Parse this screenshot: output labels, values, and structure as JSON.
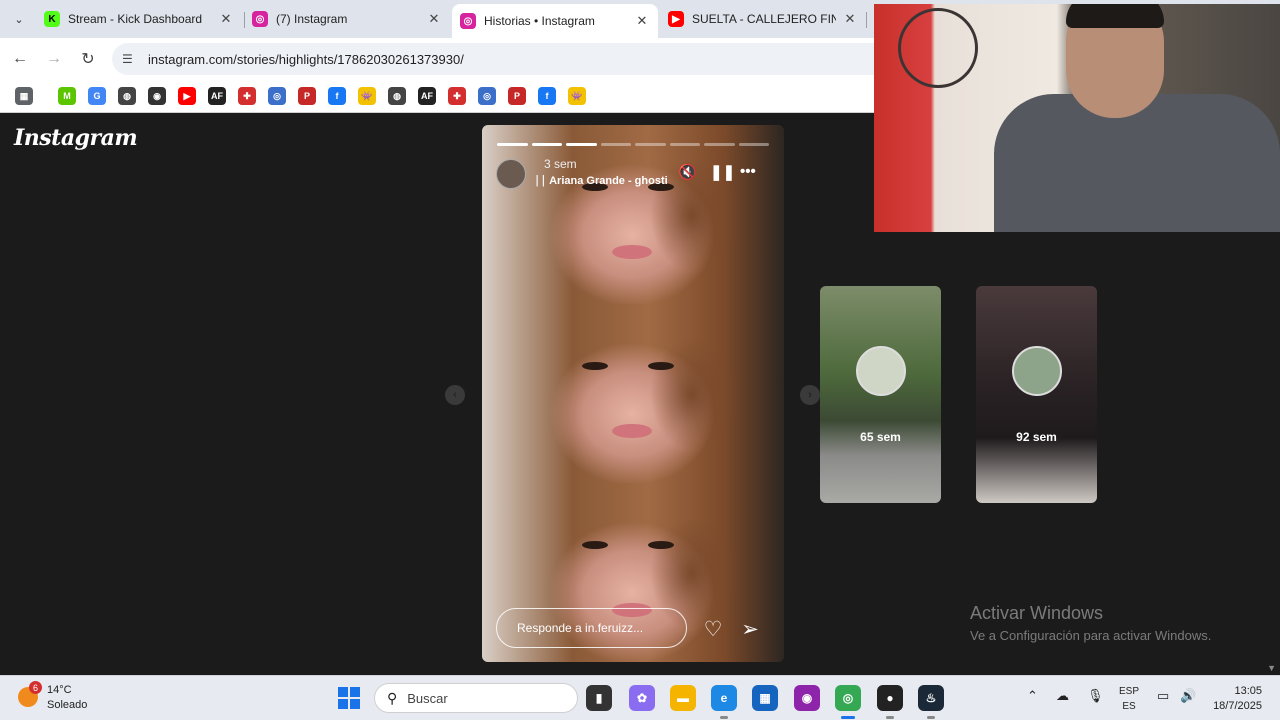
{
  "tabs": [
    {
      "title": "Stream - Kick Dashboard",
      "icon": "kick-icon",
      "color": "#53fc18"
    },
    {
      "title": "(7) Instagram",
      "icon": "instagram-icon",
      "color": "#d6249f"
    },
    {
      "title": "Historias • Instagram",
      "icon": "instagram-icon",
      "color": "#d6249f"
    },
    {
      "title": "SUELTA - CALLEJERO FINO, A",
      "icon": "youtube-icon",
      "color": "#ff0000"
    }
  ],
  "address": {
    "url": "instagram.com/stories/highlights/17862030261373930/"
  },
  "bookmarks": [
    {
      "icon": "apps-icon",
      "glyph": "▦",
      "color": "#5f6368"
    },
    {
      "icon": "movistar-icon",
      "glyph": "M",
      "color": "#5bc500"
    },
    {
      "icon": "google-icon",
      "glyph": "G",
      "color": "#4285f4"
    },
    {
      "icon": "globe-icon",
      "glyph": "◍",
      "color": "#444"
    },
    {
      "icon": "eye-icon",
      "glyph": "◉",
      "color": "#333"
    },
    {
      "icon": "youtube-icon",
      "glyph": "▶",
      "color": "#ff0000"
    },
    {
      "icon": "af-icon",
      "glyph": "AF",
      "color": "#222"
    },
    {
      "icon": "medical-icon",
      "glyph": "✚",
      "color": "#d32f2f"
    },
    {
      "icon": "badge-icon",
      "glyph": "◎",
      "color": "#3b6fc9"
    },
    {
      "icon": "p-logo-icon",
      "glyph": "P",
      "color": "#c62828"
    },
    {
      "icon": "facebook-icon",
      "glyph": "f",
      "color": "#1877f2"
    },
    {
      "icon": "invader-icon",
      "glyph": "👾",
      "color": "#f2c200"
    },
    {
      "icon": "globe-icon",
      "glyph": "◍",
      "color": "#444"
    },
    {
      "icon": "af-icon",
      "glyph": "AF",
      "color": "#222"
    },
    {
      "icon": "medical-icon",
      "glyph": "✚",
      "color": "#d32f2f"
    },
    {
      "icon": "badge-icon",
      "glyph": "◎",
      "color": "#3b6fc9"
    },
    {
      "icon": "p-logo-icon",
      "glyph": "P",
      "color": "#c62828"
    },
    {
      "icon": "facebook-icon",
      "glyph": "f",
      "color": "#1877f2"
    },
    {
      "icon": "invader-icon",
      "glyph": "👾",
      "color": "#f2c200"
    }
  ],
  "page": {
    "logo": "Instagram",
    "story": {
      "time": "3 sem",
      "music": "Ariana Grande - ghostin",
      "progress_segments": 8,
      "progress_done": 3,
      "reply_placeholder": "Responde a in.feruizz..."
    },
    "previews": [
      {
        "time": "65 sem"
      },
      {
        "time": "92 sem"
      }
    ],
    "watermark": {
      "title": "Activar Windows",
      "subtitle": "Ve a Configuración para activar Windows."
    }
  },
  "taskbar": {
    "weather": {
      "badge": "6",
      "temp": "14°C",
      "condition": "Soleado"
    },
    "search": "Buscar",
    "apps": [
      {
        "icon": "file-explorer-dark-icon",
        "glyph": "▮",
        "color": "#333"
      },
      {
        "icon": "copilot-icon",
        "glyph": "✿",
        "color": "#8a6cf0"
      },
      {
        "icon": "folder-icon",
        "glyph": "▬",
        "color": "#f4b400"
      },
      {
        "icon": "edge-icon",
        "glyph": "e",
        "color": "#1e88e5"
      },
      {
        "icon": "store-icon",
        "glyph": "▦",
        "color": "#1565c0"
      },
      {
        "icon": "recorder-icon",
        "glyph": "◉",
        "color": "#8e24aa"
      },
      {
        "icon": "chrome-icon",
        "glyph": "◎",
        "color": "#34a853"
      },
      {
        "icon": "obs-icon",
        "glyph": "●",
        "color": "#222"
      },
      {
        "icon": "steam-icon",
        "glyph": "♨",
        "color": "#1b2838"
      }
    ],
    "language": {
      "line1": "ESP",
      "line2": "ES"
    },
    "clock": {
      "time": "13:05",
      "date": "18/7/2025"
    }
  }
}
